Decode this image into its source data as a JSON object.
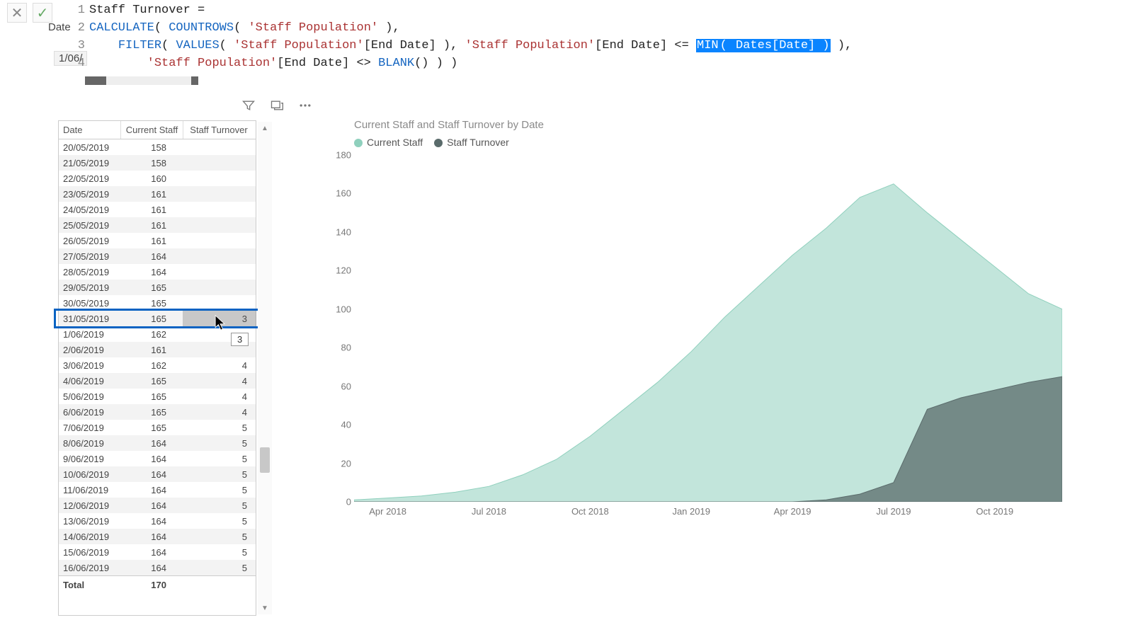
{
  "formula_bar": {
    "buttons": {
      "cancel": "✕",
      "commit": "✓"
    },
    "truncated_header": "Date",
    "truncated_value": "1/06/",
    "lines": [
      {
        "n": "1",
        "plain": "Staff Turnover ="
      },
      {
        "n": "2",
        "tokens": [
          {
            "t": "CALCULATE",
            "c": "fn"
          },
          {
            "t": "( "
          },
          {
            "t": "COUNTROWS",
            "c": "fn"
          },
          {
            "t": "( "
          },
          {
            "t": "'Staff Population'",
            "c": "str"
          },
          {
            "t": " ),"
          }
        ]
      },
      {
        "n": "3",
        "tokens": [
          {
            "t": "    "
          },
          {
            "t": "FILTER",
            "c": "fn"
          },
          {
            "t": "( "
          },
          {
            "t": "VALUES",
            "c": "fn"
          },
          {
            "t": "( "
          },
          {
            "t": "'Staff Population'",
            "c": "str"
          },
          {
            "t": "[End Date] ), "
          },
          {
            "t": "'Staff Population'",
            "c": "str"
          },
          {
            "t": "[End Date] <= "
          },
          {
            "t": "MIN",
            "c": "hl"
          },
          {
            "t": "( ",
            "c": "hl"
          },
          {
            "t": "Dates[Date] )",
            "c": "hl"
          },
          {
            "t": " ),"
          }
        ]
      },
      {
        "n": "4",
        "tokens": [
          {
            "t": "        "
          },
          {
            "t": "'Staff Population'",
            "c": "str"
          },
          {
            "t": "[End Date] <> "
          },
          {
            "t": "BLANK",
            "c": "fn"
          },
          {
            "t": "() ) )"
          }
        ]
      }
    ]
  },
  "table": {
    "headers": {
      "c1": "Date",
      "c2": "Current Staff",
      "c3": "Staff Turnover"
    },
    "rows": [
      {
        "d": "20/05/2019",
        "cs": "158",
        "st": ""
      },
      {
        "d": "21/05/2019",
        "cs": "158",
        "st": ""
      },
      {
        "d": "22/05/2019",
        "cs": "160",
        "st": ""
      },
      {
        "d": "23/05/2019",
        "cs": "161",
        "st": ""
      },
      {
        "d": "24/05/2019",
        "cs": "161",
        "st": ""
      },
      {
        "d": "25/05/2019",
        "cs": "161",
        "st": ""
      },
      {
        "d": "26/05/2019",
        "cs": "161",
        "st": ""
      },
      {
        "d": "27/05/2019",
        "cs": "164",
        "st": ""
      },
      {
        "d": "28/05/2019",
        "cs": "164",
        "st": ""
      },
      {
        "d": "29/05/2019",
        "cs": "165",
        "st": ""
      },
      {
        "d": "30/05/2019",
        "cs": "165",
        "st": ""
      },
      {
        "d": "31/05/2019",
        "cs": "165",
        "st": "3"
      },
      {
        "d": "1/06/2019",
        "cs": "162",
        "st": ""
      },
      {
        "d": "2/06/2019",
        "cs": "161",
        "st": ""
      },
      {
        "d": "3/06/2019",
        "cs": "162",
        "st": "4"
      },
      {
        "d": "4/06/2019",
        "cs": "165",
        "st": "4"
      },
      {
        "d": "5/06/2019",
        "cs": "165",
        "st": "4"
      },
      {
        "d": "6/06/2019",
        "cs": "165",
        "st": "4"
      },
      {
        "d": "7/06/2019",
        "cs": "165",
        "st": "5"
      },
      {
        "d": "8/06/2019",
        "cs": "164",
        "st": "5"
      },
      {
        "d": "9/06/2019",
        "cs": "164",
        "st": "5"
      },
      {
        "d": "10/06/2019",
        "cs": "164",
        "st": "5"
      },
      {
        "d": "11/06/2019",
        "cs": "164",
        "st": "5"
      },
      {
        "d": "12/06/2019",
        "cs": "164",
        "st": "5"
      },
      {
        "d": "13/06/2019",
        "cs": "164",
        "st": "5"
      },
      {
        "d": "14/06/2019",
        "cs": "164",
        "st": "5"
      },
      {
        "d": "15/06/2019",
        "cs": "164",
        "st": "5"
      },
      {
        "d": "16/06/2019",
        "cs": "164",
        "st": "5"
      }
    ],
    "footer": {
      "label": "Total",
      "cs": "170",
      "st": ""
    },
    "selected_row_index": 11,
    "tooltip_value": "3"
  },
  "chart": {
    "title": "Current Staff and Staff Turnover by Date",
    "legend": [
      {
        "label": "Current Staff",
        "color": "#8fd0bd"
      },
      {
        "label": "Staff Turnover",
        "color": "#5a6b6b"
      }
    ]
  },
  "chart_data": {
    "type": "area",
    "xlabel": "",
    "ylabel": "",
    "ylim": [
      0,
      180
    ],
    "yticks": [
      0,
      20,
      40,
      60,
      80,
      100,
      120,
      140,
      160,
      180
    ],
    "x_categories": [
      "Apr 2018",
      "Jul 2018",
      "Oct 2018",
      "Jan 2019",
      "Apr 2019",
      "Jul 2019",
      "Oct 2019"
    ],
    "series": [
      {
        "name": "Current Staff",
        "color": "#8fd0bd",
        "x": [
          0,
          1,
          2,
          3,
          4,
          5,
          6,
          7,
          8,
          9,
          10,
          11,
          12,
          13,
          14,
          15,
          16,
          17,
          18,
          19,
          20,
          21
        ],
        "y": [
          1,
          2,
          3,
          5,
          8,
          14,
          22,
          34,
          48,
          62,
          78,
          96,
          112,
          128,
          142,
          158,
          165,
          150,
          136,
          122,
          108,
          100
        ]
      },
      {
        "name": "Staff Turnover",
        "color": "#5a6b6b",
        "x": [
          0,
          1,
          2,
          3,
          4,
          5,
          6,
          7,
          8,
          9,
          10,
          11,
          12,
          13,
          14,
          15,
          16,
          17,
          18,
          19,
          20,
          21
        ],
        "y": [
          0,
          0,
          0,
          0,
          0,
          0,
          0,
          0,
          0,
          0,
          0,
          0,
          0,
          0,
          1,
          4,
          10,
          48,
          54,
          58,
          62,
          65
        ]
      }
    ],
    "x_range": [
      0,
      21
    ]
  }
}
